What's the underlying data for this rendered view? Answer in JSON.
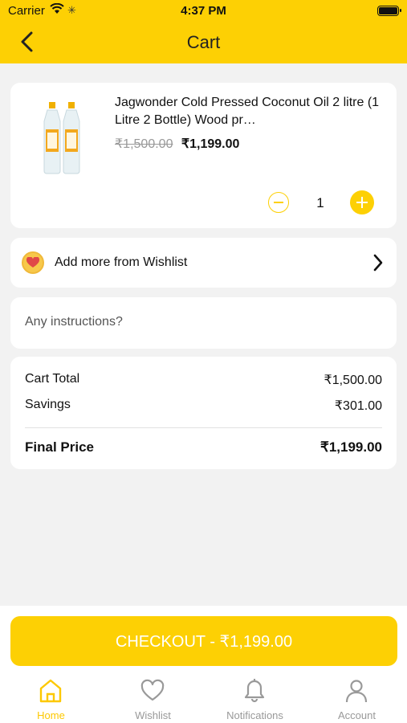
{
  "status_bar": {
    "carrier": "Carrier",
    "time": "4:37 PM"
  },
  "header": {
    "title": "Cart",
    "back_icon": "chevron-left-icon"
  },
  "cart_item": {
    "name": "Jagwonder Cold Pressed Coconut Oil 2 litre (1 Litre 2 Bottle) Wood pr…",
    "original_price": "₹1,500.00",
    "price": "₹1,199.00",
    "quantity": "1"
  },
  "wishlist_row": {
    "label": "Add more from Wishlist",
    "icon": "heart-icon"
  },
  "instructions": {
    "placeholder": "Any instructions?"
  },
  "summary": {
    "cart_total_label": "Cart Total",
    "cart_total_value": "₹1,500.00",
    "savings_label": "Savings",
    "savings_value": "₹301.00",
    "final_label": "Final Price",
    "final_value": "₹1,199.00"
  },
  "checkout_button": "CHECKOUT - ₹1,199.00",
  "tabs": [
    {
      "label": "Home",
      "icon": "home-icon",
      "active": true
    },
    {
      "label": "Wishlist",
      "icon": "heart-icon",
      "active": false
    },
    {
      "label": "Notifications",
      "icon": "bell-icon",
      "active": false
    },
    {
      "label": "Account",
      "icon": "user-icon",
      "active": false
    }
  ],
  "colors": {
    "accent": "#fdd004",
    "background": "#f2f2f2"
  }
}
